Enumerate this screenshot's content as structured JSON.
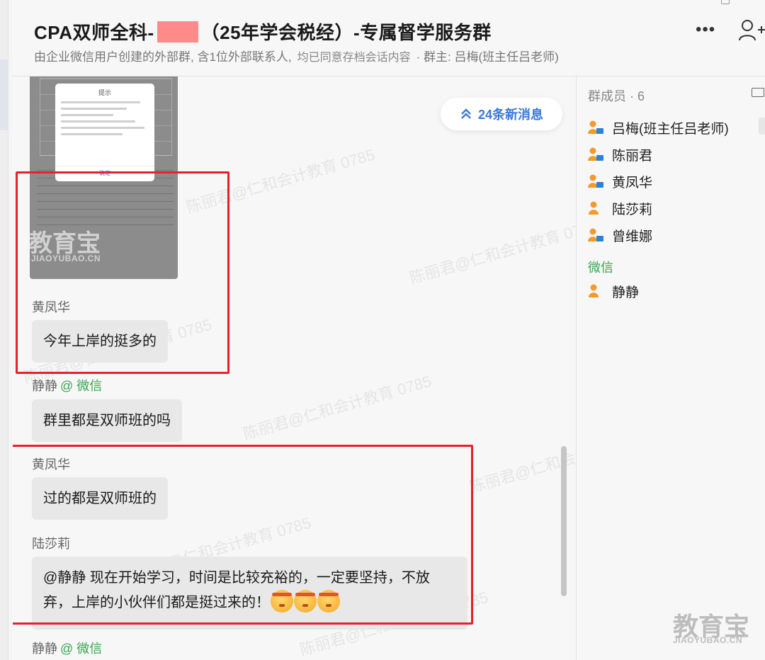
{
  "header": {
    "title_before": "CPA双师全科-",
    "title_after": "（25年学会税经）-专属督学服务群",
    "subtitle": "由企业微信用户创建的外部群, 含1位外部联系人,",
    "archive_notice": "均已同意存档会话内容",
    "owner": "· 群主: 吕梅(班主任吕老师)",
    "more_icon": "more-horizontal-icon",
    "add_member_icon": "add-member-icon"
  },
  "chat": {
    "new_messages_label": "24条新消息",
    "image_message": {
      "dialog_title": "提示",
      "dialog_ok": "确定",
      "brand": "教育宝",
      "brand_url": "JIAOYUBAO.CN"
    },
    "messages": [
      {
        "sender": "黄凤华",
        "text": "今年上岸的挺多的"
      },
      {
        "sender": "静静",
        "tag": "@ 微信",
        "text": "群里都是双师班的吗"
      },
      {
        "sender": "黄凤华",
        "text": "过的都是双师班的"
      },
      {
        "sender": "陆莎莉",
        "text_line1": "@静静  现在开始学习，时间是比较充裕的，一定要坚持，不放",
        "text_line2": "弃，上岸的小伙伴们都是挺过来的！"
      },
      {
        "sender": "静静",
        "tag": "@ 微信"
      }
    ],
    "watermark": "陈丽君@仁和会计教育 0785"
  },
  "members": {
    "title": "群成员 · 6",
    "internal": [
      {
        "name": "吕梅(班主任吕老师)",
        "icon": "employee-icon"
      },
      {
        "name": "陈丽君",
        "icon": "employee-icon"
      },
      {
        "name": "黄凤华",
        "icon": "employee-icon"
      },
      {
        "name": "陆莎莉",
        "icon": "person-icon"
      },
      {
        "name": "曾维娜",
        "icon": "employee-icon"
      }
    ],
    "wechat_label": "微信",
    "external": [
      {
        "name": "静静",
        "icon": "person-icon"
      }
    ]
  },
  "brand_corner": {
    "name": "教育宝",
    "url": "JIAOYUBAO.CN"
  },
  "colors": {
    "accent_blue": "#3c78d8",
    "wechat_green": "#3aa552",
    "highlight_red": "#e8202b",
    "person_orange": "#f39a2d"
  }
}
